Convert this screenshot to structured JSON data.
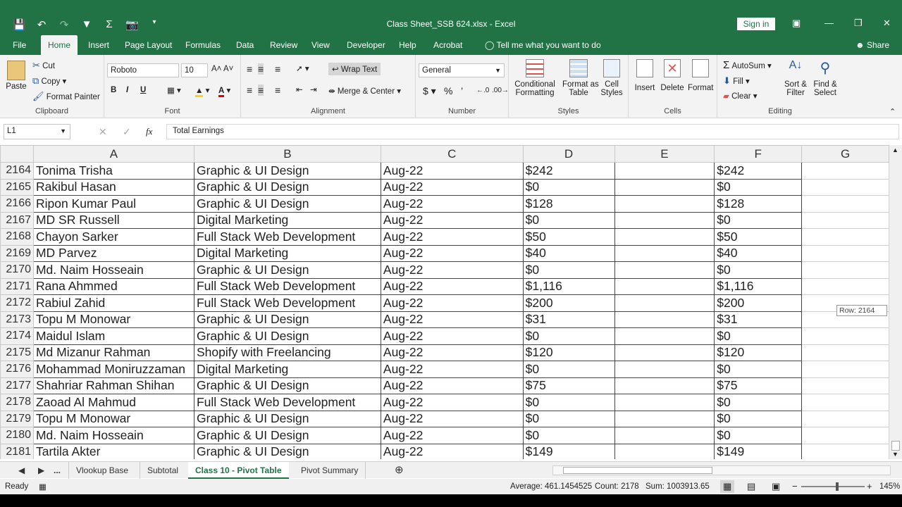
{
  "window": {
    "title": "Class Sheet_SSB 624.xlsx  -  Excel",
    "signin": "Sign in",
    "share": "Share"
  },
  "ribbon_tabs": [
    "File",
    "Home",
    "Insert",
    "Page Layout",
    "Formulas",
    "Data",
    "Review",
    "View",
    "Developer",
    "Help",
    "Acrobat"
  ],
  "tell_me": "Tell me what you want to do",
  "clipboard": {
    "paste": "Paste",
    "cut": "Cut",
    "copy": "Copy",
    "format_painter": "Format Painter",
    "label": "Clipboard"
  },
  "font": {
    "name": "Roboto",
    "size": "10",
    "bold": "B",
    "italic": "I",
    "underline": "U",
    "label": "Font"
  },
  "alignment": {
    "wrap": "Wrap Text",
    "merge": "Merge & Center",
    "label": "Alignment"
  },
  "number": {
    "format": "General",
    "currency": "$",
    "percent": "%",
    "comma": "’",
    "label": "Number"
  },
  "styles": {
    "cond1": "Conditional",
    "cond2": "Formatting",
    "fmt1": "Format as",
    "fmt2": "Table",
    "cell1": "Cell",
    "cell2": "Styles",
    "label": "Styles"
  },
  "cells": {
    "insert": "Insert",
    "delete": "Delete",
    "format": "Format",
    "label": "Cells"
  },
  "editing": {
    "autosum": "AutoSum",
    "fill": "Fill",
    "clear": "Clear",
    "sort1": "Sort &",
    "sort2": "Filter",
    "find1": "Find &",
    "find2": "Select",
    "label": "Editing"
  },
  "formula_bar": {
    "name_box": "L1",
    "fx": "fx",
    "content": "Total Earnings"
  },
  "columns": [
    "A",
    "B",
    "C",
    "D",
    "E",
    "F",
    "G"
  ],
  "rows": [
    {
      "n": "2164",
      "a": "Tonima Trisha",
      "b": "Graphic & UI Design",
      "c": "Aug-22",
      "d": "$242",
      "f": "$242"
    },
    {
      "n": "2165",
      "a": "Rakibul Hasan",
      "b": "Graphic & UI Design",
      "c": "Aug-22",
      "d": "$0",
      "f": "$0"
    },
    {
      "n": "2166",
      "a": "Ripon Kumar Paul",
      "b": "Graphic & UI Design",
      "c": "Aug-22",
      "d": "$128",
      "f": "$128"
    },
    {
      "n": "2167",
      "a": "MD SR Russell",
      "b": "Digital Marketing",
      "c": "Aug-22",
      "d": "$0",
      "f": "$0"
    },
    {
      "n": "2168",
      "a": "Chayon Sarker",
      "b": "Full Stack Web Development",
      "c": "Aug-22",
      "d": "$50",
      "f": "$50"
    },
    {
      "n": "2169",
      "a": "MD Parvez",
      "b": "Digital Marketing",
      "c": "Aug-22",
      "d": "$40",
      "f": "$40"
    },
    {
      "n": "2170",
      "a": "Md. Naim Hosseain",
      "b": "Graphic & UI Design",
      "c": "Aug-22",
      "d": "$0",
      "f": "$0"
    },
    {
      "n": "2171",
      "a": "Rana Ahmmed",
      "b": "Full Stack Web Development",
      "c": "Aug-22",
      "d": "$1,116",
      "f": "$1,116"
    },
    {
      "n": "2172",
      "a": "Rabiul Zahid",
      "b": "Full Stack Web Development",
      "c": "Aug-22",
      "d": "$200",
      "f": "$200"
    },
    {
      "n": "2173",
      "a": "Topu M Monowar",
      "b": "Graphic & UI Design",
      "c": "Aug-22",
      "d": "$31",
      "f": "$31"
    },
    {
      "n": "2174",
      "a": "Maidul Islam",
      "b": "Graphic & UI Design",
      "c": "Aug-22",
      "d": "$0",
      "f": "$0"
    },
    {
      "n": "2175",
      "a": "Md Mizanur Rahman",
      "b": "Shopify with Freelancing",
      "c": "Aug-22",
      "d": "$120",
      "f": "$120"
    },
    {
      "n": "2176",
      "a": "Mohammad Moniruzzaman",
      "b": "Digital Marketing",
      "c": "Aug-22",
      "d": "$0",
      "f": "$0"
    },
    {
      "n": "2177",
      "a": "Shahriar Rahman Shihan",
      "b": "Graphic & UI Design",
      "c": "Aug-22",
      "d": "$75",
      "f": "$75"
    },
    {
      "n": "2178",
      "a": "Zaoad Al Mahmud",
      "b": "Full Stack Web Development",
      "c": "Aug-22",
      "d": "$0",
      "f": "$0"
    },
    {
      "n": "2179",
      "a": "Topu M Monowar",
      "b": "Graphic & UI Design",
      "c": "Aug-22",
      "d": "$0",
      "f": "$0"
    },
    {
      "n": "2180",
      "a": "Md. Naim Hosseain",
      "b": "Graphic & UI Design",
      "c": "Aug-22",
      "d": "$0",
      "f": "$0"
    },
    {
      "n": "2181",
      "a": "Tartila Akter",
      "b": "Graphic & UI Design",
      "c": "Aug-22",
      "d": "$149",
      "f": "$149"
    }
  ],
  "tooltip": "Row: 2164",
  "sheet_tabs": {
    "more": "...",
    "tabs": [
      "Vlookup Base",
      "Subtotal",
      "Class 10 - Pivot Table",
      "Pivot Summary"
    ],
    "active": "Class 10 - Pivot Table"
  },
  "status": {
    "ready": "Ready",
    "average": "Average: 461.1454525",
    "count": "Count: 2178",
    "sum": "Sum: 1003913.65",
    "zoom": "145%"
  },
  "colors": {
    "excel_green": "#217346",
    "grid": "#d0d0d0"
  }
}
